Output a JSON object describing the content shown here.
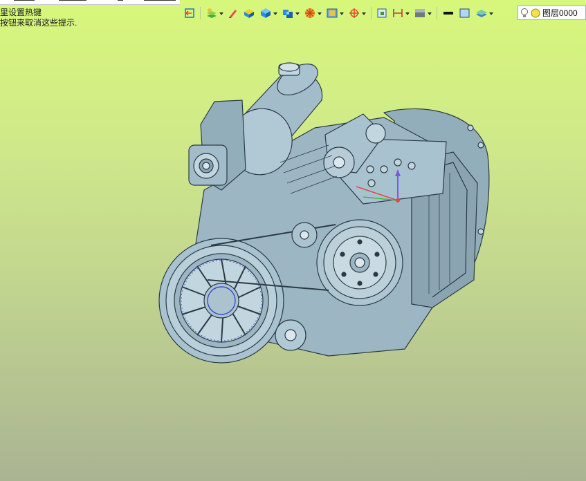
{
  "hint": {
    "line1": "里设置热键",
    "line2": "按钮来取消这些提示."
  },
  "layer": {
    "label": "图层0000"
  },
  "toolbar": {
    "buttons": [
      {
        "name": "return-icon",
        "dropdown": false
      },
      {
        "name": "layer-manager-icon",
        "dropdown": true
      },
      {
        "name": "pencil-icon",
        "dropdown": false
      },
      {
        "name": "render-icon",
        "dropdown": false
      },
      {
        "name": "shaded-cube-icon",
        "dropdown": true
      },
      {
        "name": "views-icon",
        "dropdown": true
      },
      {
        "name": "orient-icon",
        "dropdown": true
      },
      {
        "name": "display-style-icon",
        "dropdown": true
      },
      {
        "name": "triad-icon",
        "dropdown": true
      },
      {
        "name": "fit-icon",
        "dropdown": false
      },
      {
        "name": "dimension-icon",
        "dropdown": true
      },
      {
        "name": "background-icon",
        "dropdown": true
      },
      {
        "name": "line-color-icon",
        "dropdown": false
      },
      {
        "name": "color-box-icon",
        "dropdown": false
      },
      {
        "name": "layers-icon",
        "dropdown": true
      }
    ]
  },
  "colors": {
    "bg_top": "#d7f77b",
    "bg_bottom": "#aab493",
    "model_fill": "#9fb8c6",
    "model_edge": "#2a3a44"
  }
}
